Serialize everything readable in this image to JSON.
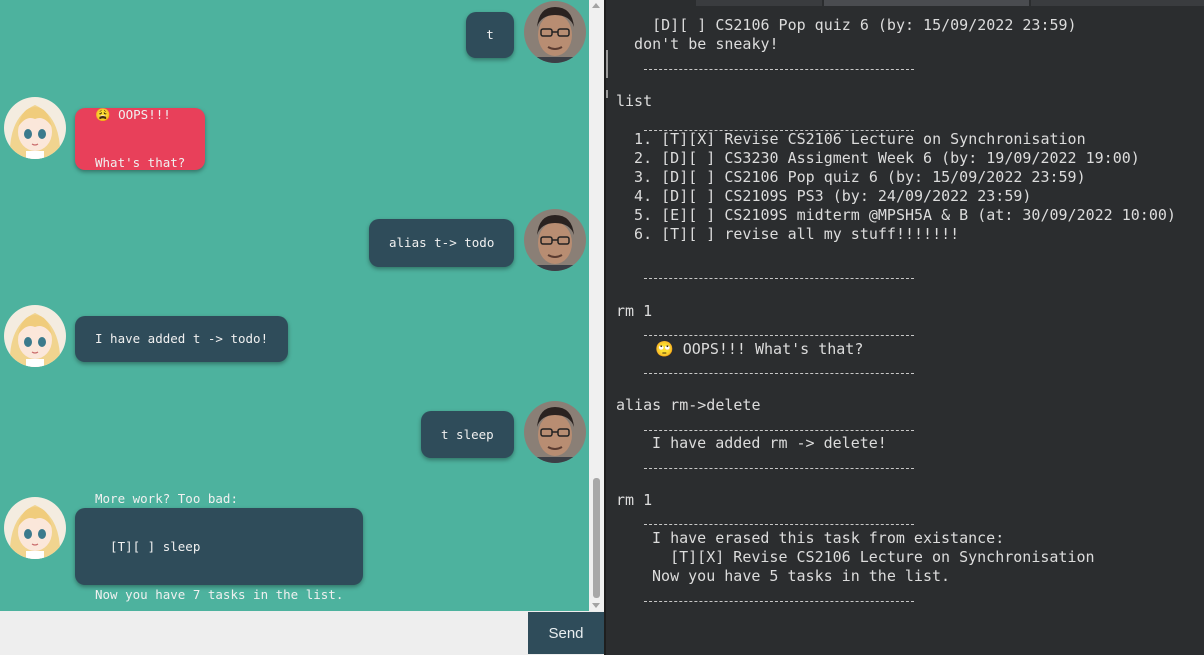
{
  "chat": {
    "messages": [
      {
        "sender": "user",
        "text": "t"
      },
      {
        "sender": "bot",
        "type": "error",
        "lines": [
          "😩 OOPS!!!",
          "What's that?"
        ]
      },
      {
        "sender": "user",
        "text": "alias t-> todo"
      },
      {
        "sender": "bot",
        "lines": [
          "I have added t -> todo!"
        ]
      },
      {
        "sender": "user",
        "text": "t sleep"
      },
      {
        "sender": "bot",
        "lines": [
          "More work? Too bad:",
          "  [T][ ] sleep",
          "Now you have 7 tasks in the list."
        ]
      }
    ],
    "input": {
      "value": "",
      "placeholder": ""
    },
    "send_label": "Send",
    "colors": {
      "background": "#4db29e",
      "bubble": "#2f4c5a",
      "error_bubble": "#e8405a"
    }
  },
  "terminal": {
    "lines": [
      "    [D][ ] CS2106 Pop quiz 6 (by: 15/09/2022 23:59)",
      "  don't be sneaky!",
      "list",
      "  1. [T][X] Revise CS2106 Lecture on Synchronisation",
      "  2. [D][ ] CS3230 Assigment Week 6 (by: 19/09/2022 19:00)",
      "  3. [D][ ] CS2106 Pop quiz 6 (by: 15/09/2022 23:59)",
      "  4. [D][ ] CS2109S PS3 (by: 24/09/2022 23:59)",
      "  5. [E][ ] CS2109S midterm @MPSH5A & B (at: 30/09/2022 10:00)",
      "  6. [T][ ] revise all my stuff!!!!!!!",
      "rm 1",
      " 🙄 OOPS!!! What's that?",
      "alias rm->delete",
      " I have added rm -> delete!",
      "rm 1",
      " I have erased this task from existance:",
      "   [T][X] Revise CS2106 Lecture on Synchronisation",
      " Now you have 5 tasks in the list."
    ]
  }
}
